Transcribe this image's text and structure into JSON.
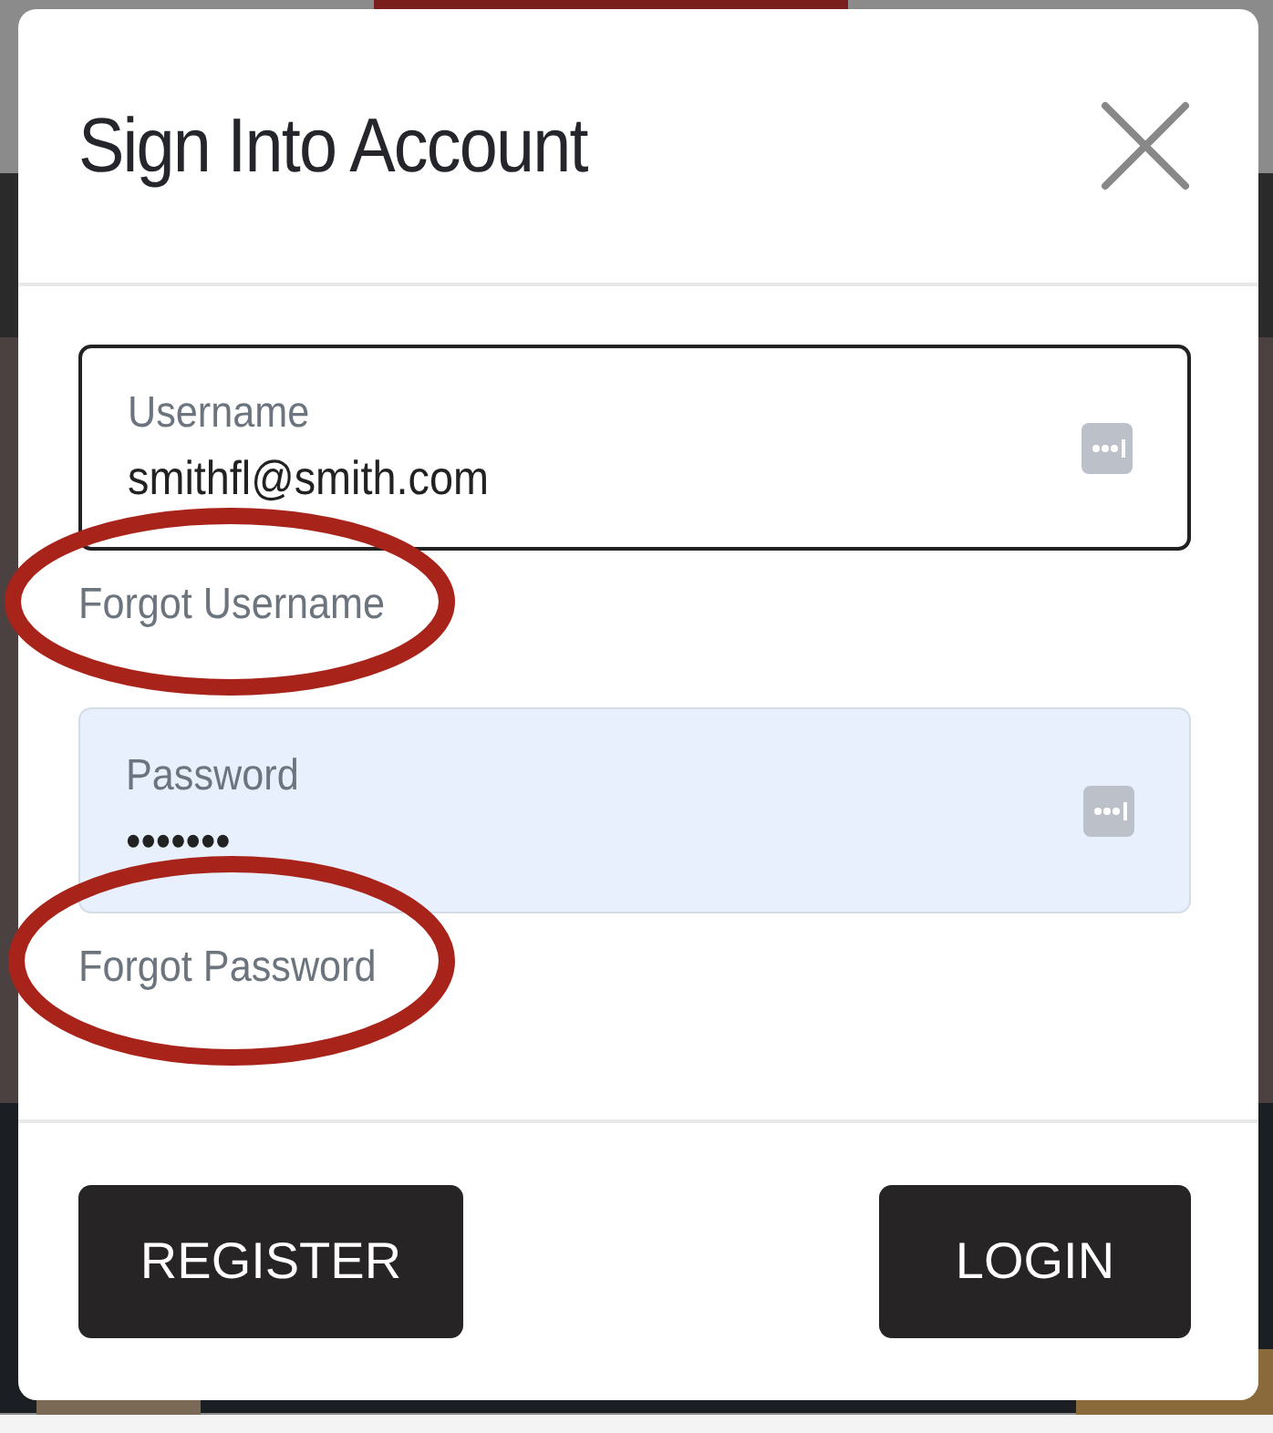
{
  "dialog": {
    "title": "Sign Into Account"
  },
  "fields": [
    {
      "label": "Username",
      "value": "smithfl@smith.com",
      "autofilled": false,
      "focused": true,
      "link": "Forgot Username"
    },
    {
      "label": "Password",
      "value": "•••••••",
      "autofilled": true,
      "focused": false,
      "link": "Forgot Password"
    }
  ],
  "buttons": [
    "REGISTER",
    "LOGIN"
  ]
}
